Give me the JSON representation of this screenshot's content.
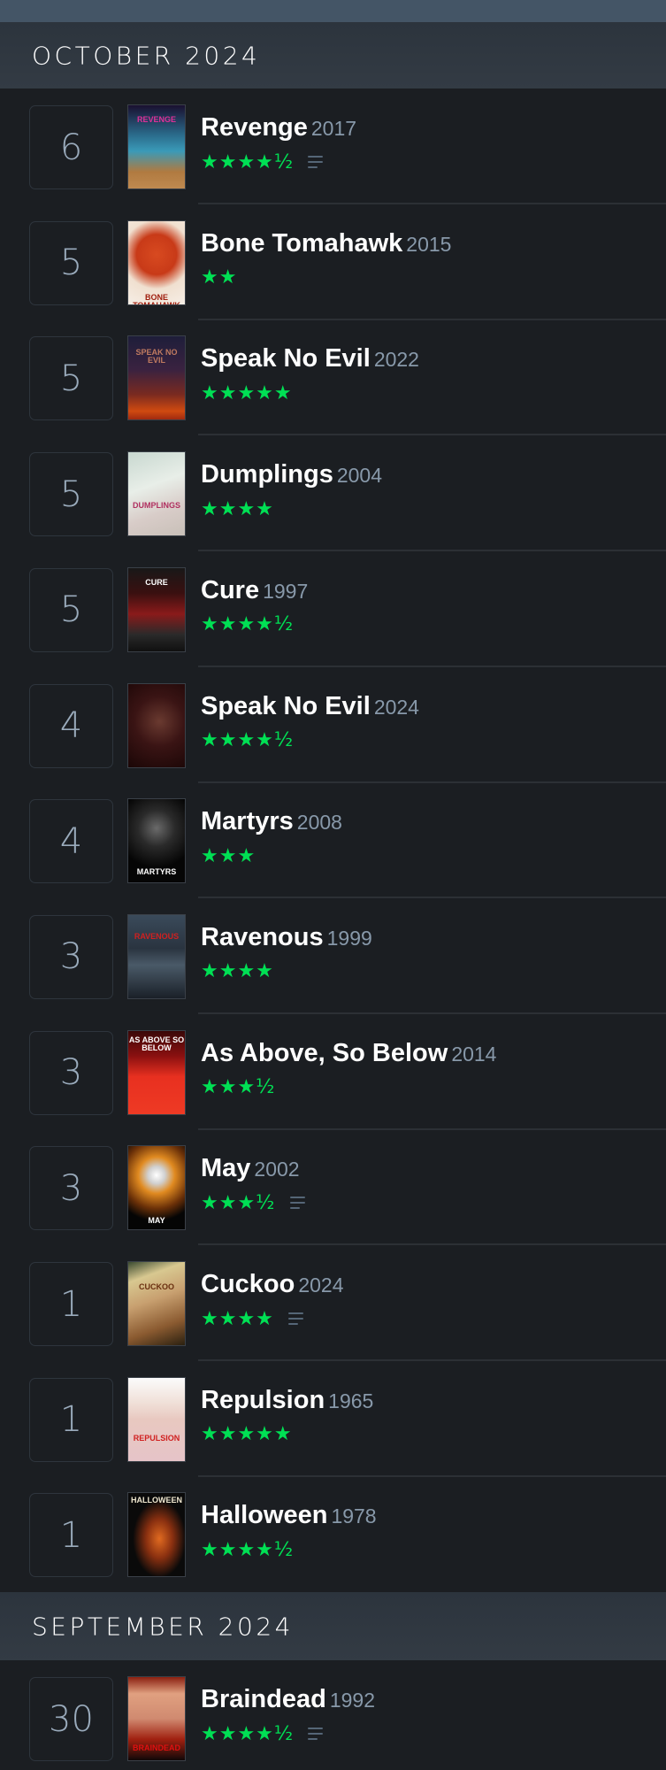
{
  "colors": {
    "topbar": "#445566",
    "header_bg": "#2f3740",
    "body_bg": "#1b1e22",
    "star_green": "#00e054",
    "year_gray": "#8899aa",
    "day_gray": "#9aabbc"
  },
  "sections": [
    {
      "month_label": "OCTOBER 2024",
      "entries": [
        {
          "day": "6",
          "title": "Revenge",
          "year": "2017",
          "rating": 4.5,
          "stars": "★★★★½",
          "has_review": true,
          "poster_icon": "poster-revenge"
        },
        {
          "day": "5",
          "title": "Bone Tomahawk",
          "year": "2015",
          "rating": 2,
          "stars": "★★",
          "has_review": false,
          "poster_icon": "poster-bone-tomahawk"
        },
        {
          "day": "5",
          "title": "Speak No Evil",
          "year": "2022",
          "rating": 5,
          "stars": "★★★★★",
          "has_review": false,
          "poster_icon": "poster-speak-no-evil-2022"
        },
        {
          "day": "5",
          "title": "Dumplings",
          "year": "2004",
          "rating": 4,
          "stars": "★★★★",
          "has_review": false,
          "poster_icon": "poster-dumplings"
        },
        {
          "day": "5",
          "title": "Cure",
          "year": "1997",
          "rating": 4.5,
          "stars": "★★★★½",
          "has_review": false,
          "poster_icon": "poster-cure"
        },
        {
          "day": "4",
          "title": "Speak No Evil",
          "year": "2024",
          "rating": 4.5,
          "stars": "★★★★½",
          "has_review": false,
          "poster_icon": "poster-speak-no-evil-2024"
        },
        {
          "day": "4",
          "title": "Martyrs",
          "year": "2008",
          "rating": 3,
          "stars": "★★★",
          "has_review": false,
          "poster_icon": "poster-martyrs"
        },
        {
          "day": "3",
          "title": "Ravenous",
          "year": "1999",
          "rating": 4,
          "stars": "★★★★",
          "has_review": false,
          "poster_icon": "poster-ravenous"
        },
        {
          "day": "3",
          "title": "As Above, So Below",
          "year": "2014",
          "rating": 3.5,
          "stars": "★★★½",
          "has_review": false,
          "poster_icon": "poster-as-above-so-below"
        },
        {
          "day": "3",
          "title": "May",
          "year": "2002",
          "rating": 3.5,
          "stars": "★★★½",
          "has_review": true,
          "poster_icon": "poster-may"
        },
        {
          "day": "1",
          "title": "Cuckoo",
          "year": "2024",
          "rating": 4,
          "stars": "★★★★",
          "has_review": true,
          "poster_icon": "poster-cuckoo"
        },
        {
          "day": "1",
          "title": "Repulsion",
          "year": "1965",
          "rating": 5,
          "stars": "★★★★★",
          "has_review": false,
          "poster_icon": "poster-repulsion"
        },
        {
          "day": "1",
          "title": "Halloween",
          "year": "1978",
          "rating": 4.5,
          "stars": "★★★★½",
          "has_review": false,
          "poster_icon": "poster-halloween"
        }
      ]
    },
    {
      "month_label": "SEPTEMBER 2024",
      "entries": [
        {
          "day": "30",
          "title": "Braindead",
          "year": "1992",
          "rating": 4.5,
          "stars": "★★★★½",
          "has_review": true,
          "poster_icon": "poster-braindead"
        }
      ]
    }
  ],
  "posters": {
    "poster-revenge": {
      "text": "REVENGE",
      "text_color": "#e0309a"
    },
    "poster-bone-tomahawk": {
      "text": "BONE TOMAHAWK",
      "text_color": "#a02010"
    },
    "poster-speak-no-evil-2022": {
      "text": "SPEAK NO EVIL",
      "text_color": "#c07a60"
    },
    "poster-dumplings": {
      "text": "DUMPLINGS",
      "text_color": "#b03060"
    },
    "poster-cure": {
      "text": "CURE",
      "text_color": "#ffffff"
    },
    "poster-speak-no-evil-2024": {
      "text": "",
      "text_color": "#ffffff"
    },
    "poster-martyrs": {
      "text": "MARTYRS",
      "text_color": "#ffffff"
    },
    "poster-ravenous": {
      "text": "RAVENOUS",
      "text_color": "#d02020"
    },
    "poster-as-above-so-below": {
      "text": "AS ABOVE SO BELOW",
      "text_color": "#ffffff"
    },
    "poster-may": {
      "text": "MAY",
      "text_color": "#ffffff"
    },
    "poster-cuckoo": {
      "text": "CUCKOO",
      "text_color": "#6a3010"
    },
    "poster-repulsion": {
      "text": "REPULSION",
      "text_color": "#d02020"
    },
    "poster-halloween": {
      "text": "HALLOWEEN",
      "text_color": "#f0e8d0"
    },
    "poster-braindead": {
      "text": "BRAINDEAD",
      "text_color": "#e01010"
    }
  }
}
